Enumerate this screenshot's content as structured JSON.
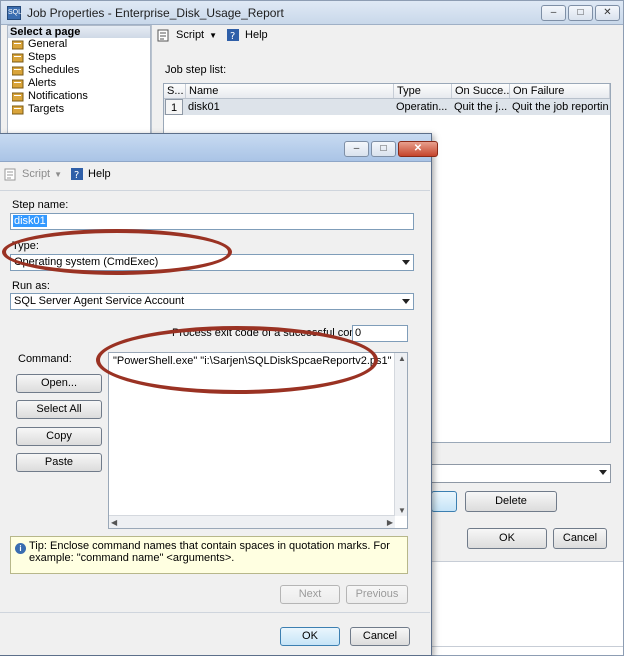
{
  "back_window": {
    "title": "Job Properties - Enterprise_Disk_Usage_Report",
    "title_icon": "job-properties-icon",
    "select_page_header": "Select a page",
    "pages": [
      "General",
      "Steps",
      "Schedules",
      "Alerts",
      "Notifications",
      "Targets"
    ],
    "toolbar": {
      "script_label": "Script",
      "help_label": "Help"
    },
    "job_step_list_label": "Job step list:",
    "grid": {
      "columns": [
        "S...",
        "Name",
        "Type",
        "On Succe...",
        "On Failure"
      ],
      "rows": [
        {
          "step": "1",
          "name": "disk01",
          "type": "Operatin...",
          "on_success": "Quit the j...",
          "on_failure": "Quit the job reporting..."
        }
      ]
    },
    "delete_label": "Delete",
    "ok_label": "OK",
    "cancel_label": "Cancel"
  },
  "front_window": {
    "toolbar": {
      "script_label": "Script",
      "help_label": "Help"
    },
    "step_name_label": "Step name:",
    "step_name_value": "disk01",
    "type_label": "Type:",
    "type_value": "Operating system (CmdExec)",
    "run_as_label": "Run as:",
    "run_as_value": "SQL Server Agent Service Account",
    "exit_code_label": "Process exit code of a successful command:",
    "exit_code_value": "0",
    "command_label": "Command:",
    "command_value": "\"PowerShell.exe\" \"i:\\Sarjen\\SQLDiskSpcaeReportv2.ps1\"",
    "buttons": {
      "open": "Open...",
      "select_all": "Select All",
      "copy": "Copy",
      "paste": "Paste"
    },
    "tip_text": "Tip: Enclose command names that contain spaces in quotation marks. For example: \"command name\" <arguments>.",
    "next_label": "Next",
    "previous_label": "Previous",
    "ok_label": "OK",
    "cancel_label": "Cancel"
  },
  "colors": {
    "annotation": "#9a3223",
    "selection": "#3399ff"
  }
}
